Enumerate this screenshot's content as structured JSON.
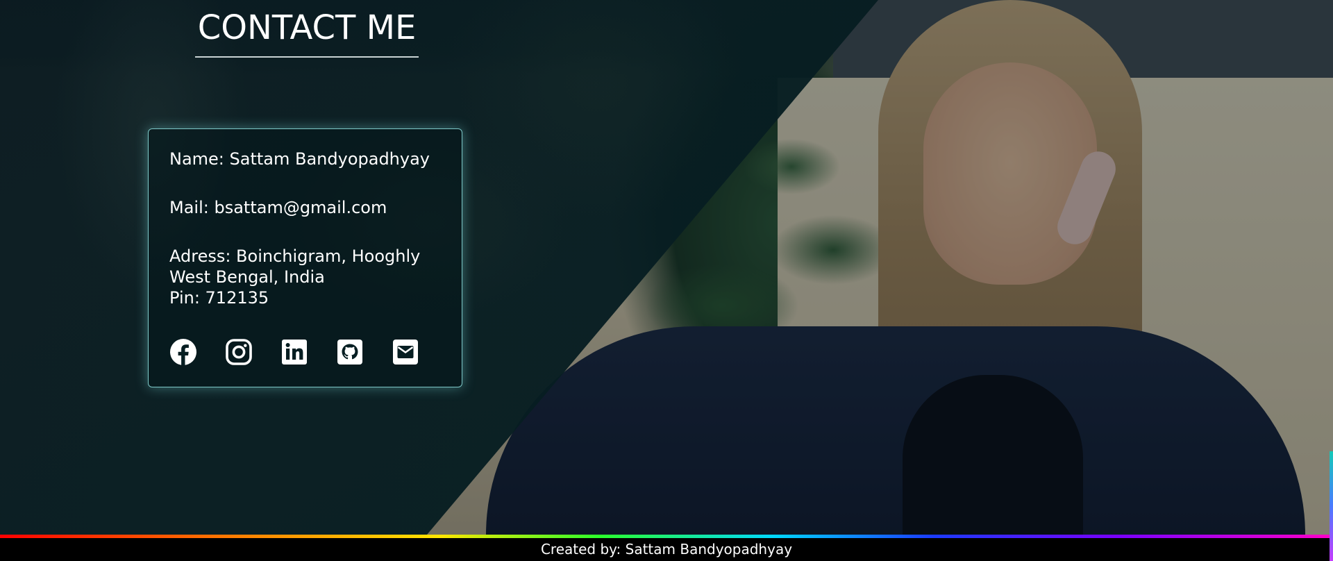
{
  "section": {
    "heading": "CONTACT ME"
  },
  "contact_card": {
    "name_line": "Name: Sattam Bandyopadhyay",
    "mail_line": "Mail: bsattam@gmail.com",
    "address_line1": "Adress: Boinchigram, Hooghly",
    "address_line2": "West Bengal, India",
    "pin_line": "Pin: 712135"
  },
  "social_links": [
    {
      "icon": "facebook-icon"
    },
    {
      "icon": "instagram-icon"
    },
    {
      "icon": "linkedin-icon"
    },
    {
      "icon": "github-icon"
    },
    {
      "icon": "envelope-icon"
    }
  ],
  "footer": {
    "credit": "Created by: Sattam Bandyopadhyay"
  },
  "colors": {
    "panel": "#061e22",
    "card_border": "#7ec9c9",
    "text": "#ffffff",
    "footer_bg": "#000000"
  }
}
